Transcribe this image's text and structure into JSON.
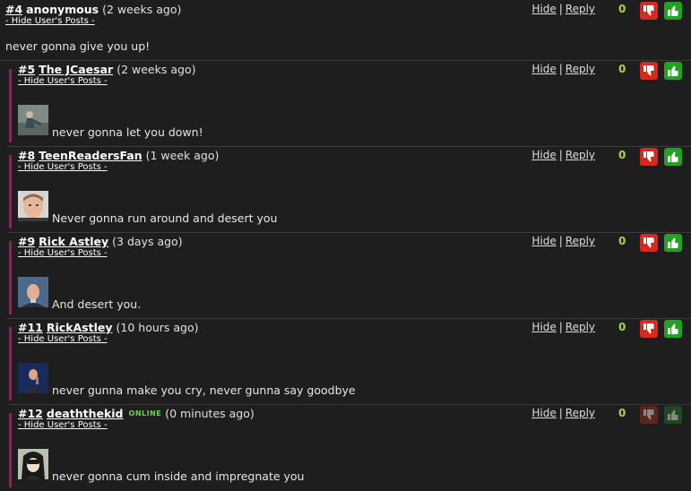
{
  "links": {
    "hide": "Hide",
    "sep": "|",
    "reply": "Reply",
    "hide_users_posts": "- Hide User's Posts -"
  },
  "colors": {
    "score": "#a0d940",
    "thumbs_down": "#d62a1e",
    "thumbs_up": "#23a123",
    "online": "#6fd04a",
    "reply_bar": "#7a2a55"
  },
  "comments": [
    {
      "num": "#4",
      "user": "anonymous",
      "time": "(2 weeks ago)",
      "score": "0",
      "text": "never gonna give you up!"
    },
    {
      "num": "#5",
      "user": "The JCaesar",
      "time": "(2 weeks ago)",
      "score": "0",
      "text": "never gonna let you down!",
      "avatar": "avatar-photo"
    },
    {
      "num": "#8",
      "user": "TeenReadersFan",
      "time": "(1 week ago)",
      "score": "0",
      "text": "Never gonna run around and desert you",
      "avatar": "avatar-photo"
    },
    {
      "num": "#9",
      "user": "Rick Astley",
      "time": "(3 days ago)",
      "score": "0",
      "text": "And desert you.",
      "avatar": "avatar-photo"
    },
    {
      "num": "#11",
      "user": "RickAstley",
      "time": "(10 hours ago)",
      "score": "0",
      "text": "never gunna make you cry, never gunna say goodbye",
      "avatar": "avatar-photo"
    },
    {
      "num": "#12",
      "user": "deaththekid",
      "online": "ONLINE",
      "time": "(0 minutes ago)",
      "score": "0",
      "text": "never gonna cum inside and impregnate you",
      "avatar": "avatar-anime"
    }
  ]
}
